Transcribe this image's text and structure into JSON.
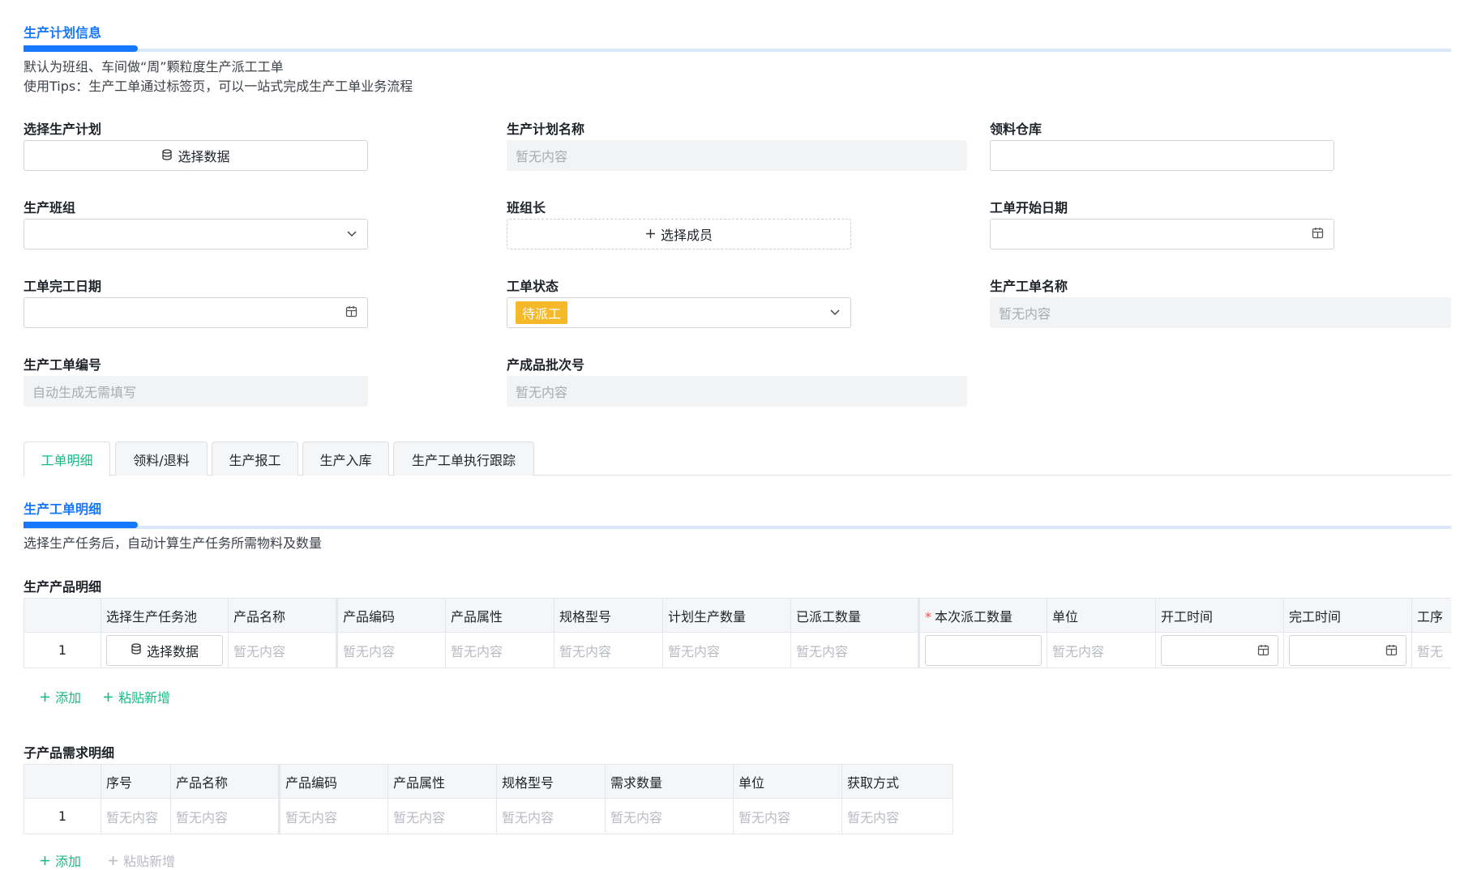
{
  "plan_section": {
    "title": "生产计划信息",
    "desc_line1": "默认为班组、车间做“周”颗粒度生产派工工单",
    "desc_line2": "使用Tips：生产工单通过标签页，可以一站式完成生产工单业务流程"
  },
  "form": {
    "select_plan": {
      "label": "选择生产计划",
      "button": "选择数据"
    },
    "plan_name": {
      "label": "生产计划名称",
      "placeholder": "暂无内容"
    },
    "warehouse": {
      "label": "领料仓库",
      "value": ""
    },
    "team": {
      "label": "生产班组",
      "value": ""
    },
    "team_leader": {
      "label": "班组长",
      "button": "选择成员"
    },
    "start_date": {
      "label": "工单开始日期",
      "value": ""
    },
    "finish_date": {
      "label": "工单完工日期",
      "value": ""
    },
    "status": {
      "label": "工单状态",
      "value": "待派工"
    },
    "order_name": {
      "label": "生产工单名称",
      "placeholder": "暂无内容"
    },
    "order_no": {
      "label": "生产工单编号",
      "placeholder": "自动生成无需填写"
    },
    "batch_no": {
      "label": "产成品批次号",
      "placeholder": "暂无内容"
    }
  },
  "tabs": [
    {
      "label": "工单明细",
      "active": true
    },
    {
      "label": "领料/退料",
      "active": false
    },
    {
      "label": "生产报工",
      "active": false
    },
    {
      "label": "生产入库",
      "active": false
    },
    {
      "label": "生产工单执行跟踪",
      "active": false
    }
  ],
  "detail_section": {
    "title": "生产工单明细",
    "desc": "选择生产任务后，自动计算生产任务所需物料及数量"
  },
  "product_table": {
    "title": "生产产品明细",
    "headers": [
      "选择生产任务池",
      "产品名称",
      "产品编码",
      "产品属性",
      "规格型号",
      "计划生产数量",
      "已派工数量",
      "本次派工数量",
      "单位",
      "开工时间",
      "完工时间",
      "工序"
    ],
    "required_marker": "*",
    "row": {
      "index": "1",
      "select_button": "选择数据",
      "placeholder": "暂无内容",
      "partial_placeholder": "暂无"
    },
    "actions": {
      "add": "添加",
      "paste": "粘贴新增"
    }
  },
  "sub_table": {
    "title": "子产品需求明细",
    "headers": [
      "序号",
      "产品名称",
      "产品编码",
      "产品属性",
      "规格型号",
      "需求数量",
      "单位",
      "获取方式"
    ],
    "row": {
      "index": "1",
      "placeholder": "暂无内容"
    },
    "actions": {
      "add": "添加",
      "paste": "粘贴新增"
    }
  },
  "colors": {
    "primary": "#1677ff",
    "green": "#17b885",
    "tag": "#f5b829"
  }
}
